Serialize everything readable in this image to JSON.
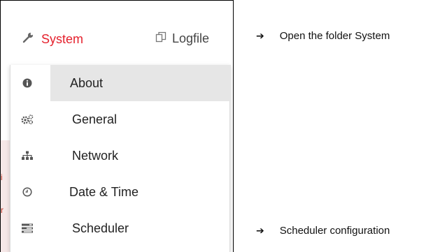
{
  "nav": {
    "system_label": "System",
    "logfile_label": "Logfile",
    "system_color": "#e5212d"
  },
  "menu": {
    "items": [
      {
        "label": "About",
        "icon": "info-circle-icon",
        "active": true
      },
      {
        "label": "General",
        "icon": "gears-icon",
        "active": false
      },
      {
        "label": "Network",
        "icon": "sitemap-icon",
        "active": false
      },
      {
        "label": "Date & Time",
        "icon": "clock-icon",
        "active": false
      },
      {
        "label": "Scheduler",
        "icon": "tasks-list-icon",
        "active": false
      }
    ]
  },
  "annotations": {
    "arrow_glyph": "➔",
    "open_folder": "Open the folder System",
    "scheduler": "Scheduler configuration"
  }
}
